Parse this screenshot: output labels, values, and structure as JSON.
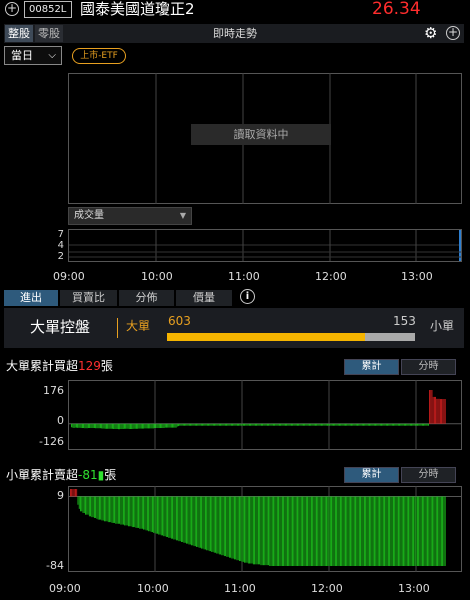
{
  "header": {
    "stock_code": "00852L",
    "stock_name": "國泰美國道瓊正2",
    "price": "26.34",
    "tabs": [
      "整股",
      "零股"
    ],
    "chart_title": "即時走勢",
    "period": "當日",
    "badge": "上市-ETF"
  },
  "main_chart": {
    "loading_text": "讀取資料中",
    "volume_selector": "成交量",
    "volume_ticks": [
      "7",
      "4",
      "2"
    ],
    "time_labels": [
      "09:00",
      "10:00",
      "11:00",
      "12:00",
      "13:00"
    ]
  },
  "bottom_tabs": [
    "進出",
    "買賣比",
    "分佈",
    "價量"
  ],
  "control_panel": {
    "title": "大單控盤",
    "big_label": "大單",
    "big_value": "603",
    "small_value": "153",
    "small_label": "小單",
    "big_fraction": 0.797
  },
  "big_order": {
    "title_prefix": "大單累計買超",
    "value": "129",
    "unit": "張",
    "toggle_cumulative": "累計",
    "toggle_interval": "分時",
    "y_labels": [
      "176",
      "0",
      "-126"
    ]
  },
  "small_order": {
    "title_prefix": "小單累計賣超",
    "value": "-81",
    "unit": "張",
    "toggle_cumulative": "累計",
    "toggle_interval": "分時",
    "y_labels": [
      "9",
      "-84"
    ],
    "time_labels": [
      "09:00",
      "10:00",
      "11:00",
      "12:00",
      "13:00"
    ]
  },
  "chart_data": [
    {
      "type": "bar",
      "title": "大單累計買超",
      "x_range": [
        "09:00",
        "13:30"
      ],
      "ylim": [
        -126,
        176
      ],
      "colors": {
        "positive": "#e02020",
        "negative": "#1fd41f"
      },
      "values": [
        0,
        -18,
        -20,
        -22,
        -20,
        -20,
        -21,
        -21,
        -21,
        -22,
        -22,
        -22,
        -23,
        -23,
        -23,
        -22,
        -22,
        -22,
        -22,
        -22,
        -22,
        -23,
        -23,
        -23,
        -23,
        -23,
        -24,
        -25,
        -25,
        -26,
        -26,
        -26,
        -26,
        -26,
        -26,
        -26,
        -27,
        -27,
        -27,
        -27,
        -28,
        -28,
        -27,
        -27,
        -27,
        -26,
        -26,
        -26,
        -26,
        -27,
        -27,
        -27,
        -27,
        -26,
        -26,
        -26,
        -26,
        -25,
        -25,
        -25,
        -25,
        -25,
        -24,
        -24,
        -24,
        -24,
        -24,
        -24,
        -24,
        -24,
        -22,
        -22,
        -22,
        -22,
        -22,
        -22,
        -22,
        -22,
        -22,
        -20,
        -20,
        -20,
        -20,
        -20,
        -20,
        -20,
        -20,
        -20,
        -20,
        -14,
        -12,
        -10,
        -10,
        -10,
        -10,
        -10,
        -10,
        -10,
        -10,
        -10,
        -10,
        -10,
        -10,
        -10,
        -10,
        -10,
        -10,
        -10,
        -10,
        -10,
        -10,
        -10,
        -10,
        -10,
        -10,
        -10,
        -10,
        -10,
        -10,
        -10,
        -10,
        -10,
        -10,
        -10,
        -10,
        -10,
        -10,
        -10,
        -10,
        -10,
        -10,
        -10,
        -10,
        -10,
        -10,
        -10,
        -10,
        -10,
        -10,
        -10,
        -10,
        -10,
        -10,
        -10,
        -10,
        -10,
        -10,
        -10,
        -10,
        -10,
        -10,
        -10,
        -10,
        -10,
        -10,
        -10,
        -10,
        -10,
        -10,
        -10,
        -10,
        -10,
        -10,
        -10,
        -10,
        -10,
        -10,
        -10,
        -10,
        -10,
        -10,
        -10,
        -10,
        -10,
        -10,
        -10,
        -10,
        -10,
        -10,
        -10,
        -10,
        -10,
        -10,
        -10,
        -10,
        -10,
        -10,
        -10,
        -10,
        -10,
        -10,
        -10,
        -10,
        -10,
        -10,
        -10,
        -10,
        -10,
        -10,
        -10,
        -10,
        -10,
        -10,
        -10,
        -10,
        -10,
        -10,
        -10,
        -10,
        -10,
        -10,
        -10,
        -10,
        -10,
        -10,
        -10,
        -10,
        -10,
        -10,
        -10,
        -10,
        -10,
        -10,
        -10,
        -10,
        -10,
        -10,
        -10,
        -10,
        -10,
        -10,
        -10,
        -10,
        -10,
        -10,
        -10,
        -10,
        -10,
        -10,
        -10,
        -10,
        -10,
        -10,
        -10,
        -10,
        -10,
        -10,
        -10,
        -10,
        -10,
        -10,
        -10,
        -10,
        -10,
        -10,
        -10,
        -10,
        -10,
        -10,
        -10,
        -10,
        -10,
        -10,
        -10,
        -10,
        -10,
        -10,
        -10,
        -10,
        -10,
        -10,
        -10,
        -10,
        -10,
        -10,
        -10,
        -10,
        -10,
        -10,
        -10,
        -10,
        -10,
        -10,
        -10,
        -10,
        -10,
        -10,
        -10,
        -10,
        -10,
        -10,
        -10,
        -10,
        -10,
        -10,
        -10,
        -10,
        -10,
        -10,
        176,
        176,
        176,
        140,
        140,
        140,
        130,
        130,
        130,
        129,
        129,
        129,
        129,
        129
      ]
    },
    {
      "type": "bar",
      "title": "小單累計賣超",
      "x_range": [
        "09:00",
        "13:30"
      ],
      "ylim": [
        -84,
        9
      ],
      "colors": {
        "positive": "#e02020",
        "negative": "#1fd41f"
      },
      "values": [
        9,
        9,
        9,
        9,
        9,
        9,
        -10,
        -15,
        -18,
        -18,
        -20,
        -20,
        -22,
        -22,
        -22,
        -24,
        -24,
        -25,
        -25,
        -26,
        -26,
        -27,
        -28,
        -28,
        -28,
        -29,
        -29,
        -30,
        -30,
        -30,
        -31,
        -31,
        -31,
        -32,
        -32,
        -32,
        -33,
        -33,
        -33,
        -33,
        -34,
        -34,
        -34,
        -35,
        -35,
        -35,
        -36,
        -36,
        -36,
        -37,
        -37,
        -37,
        -38,
        -38,
        -38,
        -39,
        -39,
        -39,
        -40,
        -40,
        -41,
        -41,
        -42,
        -42,
        -43,
        -43,
        -44,
        -44,
        -45,
        -45,
        -46,
        -46,
        -47,
        -47,
        -48,
        -48,
        -49,
        -49,
        -50,
        -50,
        -51,
        -51,
        -52,
        -52,
        -53,
        -53,
        -54,
        -54,
        -55,
        -55,
        -56,
        -56,
        -57,
        -57,
        -58,
        -58,
        -59,
        -59,
        -60,
        -60,
        -61,
        -61,
        -62,
        -62,
        -63,
        -63,
        -64,
        -64,
        -65,
        -65,
        -66,
        -66,
        -67,
        -67,
        -68,
        -68,
        -69,
        -69,
        -70,
        -70,
        -71,
        -71,
        -72,
        -72,
        -73,
        -73,
        -74,
        -74,
        -75,
        -75,
        -76,
        -76,
        -77,
        -77,
        -78,
        -78,
        -79,
        -79,
        -80,
        -80,
        -80,
        -81,
        -81,
        -81,
        -81,
        -82,
        -82,
        -82,
        -82,
        -82,
        -82,
        -83,
        -83,
        -83,
        -83,
        -83,
        -83,
        -83,
        -84,
        -84,
        -84,
        -84,
        -84,
        -84,
        -84,
        -84,
        -84,
        -84,
        -84,
        -84,
        -84,
        -84,
        -84,
        -84,
        -84,
        -84,
        -84,
        -84,
        -84,
        -84,
        -84,
        -84,
        -84,
        -84,
        -84,
        -84,
        -84,
        -84,
        -84,
        -84,
        -84,
        -84,
        -84,
        -84,
        -84,
        -84,
        -84,
        -84,
        -84,
        -84,
        -84,
        -84,
        -84,
        -84,
        -84,
        -84,
        -84,
        -84,
        -84,
        -84,
        -84,
        -84,
        -84,
        -84,
        -84,
        -84,
        -84,
        -84,
        -84,
        -84,
        -84,
        -84,
        -84,
        -84,
        -84,
        -84,
        -84,
        -84,
        -84,
        -84,
        -84,
        -84,
        -84,
        -84,
        -84,
        -84,
        -84,
        -84,
        -84,
        -84,
        -84,
        -84,
        -84,
        -84,
        -84,
        -84,
        -84,
        -84,
        -84,
        -84,
        -84,
        -84,
        -84,
        -84,
        -84,
        -84,
        -84,
        -84,
        -84,
        -84,
        -84,
        -84,
        -84,
        -84,
        -84,
        -84,
        -84,
        -84,
        -84,
        -84,
        -84,
        -84,
        -84,
        -84,
        -84,
        -84,
        -84,
        -84,
        -84,
        -84,
        -84,
        -84,
        -84,
        -84,
        -84,
        -84,
        -84,
        -84,
        -84,
        -84,
        -84,
        -84,
        -84,
        -84,
        -84,
        -84,
        -84,
        -84
      ]
    }
  ]
}
